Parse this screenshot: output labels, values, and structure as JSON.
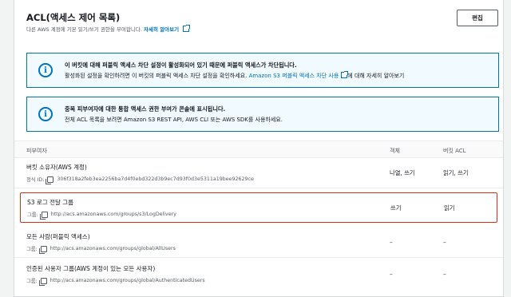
{
  "header": {
    "title": "ACL(액세스 제어 목록)",
    "subtitle": "다른 AWS 계정에 기본 읽기/쓰기 권한을 부여합니다.",
    "learn_more": "자세히 알아보기",
    "edit_label": "편집"
  },
  "alerts": [
    {
      "title": "이 버킷에 대해 퍼블릭 액세스 차단 설정이 활성화되어 있기 때문에 퍼블릭 액세스가 차단됩니다.",
      "body_prefix": "활성화된 설정을 확인하려면 이 버킷의 퍼블릭 액세스 차단 설정을 확인하세요. ",
      "body_link": "Amazon S3 퍼블릭 액세스 차단 사용",
      "body_suffix": "에 대해 자세히 알아보기"
    },
    {
      "title": "중복 피부여자에 대한 통합 액세스 권한 부여가 콘솔에 표시됩니다.",
      "body": "전체 ACL 목록을 보려면 Amazon S3 REST API, AWS CLI 또는 AWS SDK를 사용하세요."
    }
  ],
  "table": {
    "columns": [
      "피부여자",
      "객체",
      "버킷 ACL"
    ],
    "rows": [
      {
        "grantee": "버킷 소유자(AWS 계정)",
        "id_label": "정식 ID:",
        "id_value": "306f318a2feb3ea2256ba7d4f0ebd322d3b9ec7d93f0d3e5311a19bee92629ce",
        "object": "나열, 쓰기",
        "bucket_acl": "읽기, 쓰기"
      },
      {
        "grantee": "S3 로그 전달 그룹",
        "id_label": "그룹:",
        "id_value": "http://acs.amazonaws.com/groups/s3/LogDelivery",
        "object": "쓰기",
        "bucket_acl": "읽기"
      },
      {
        "grantee": "모든 사람(퍼블릭 액세스)",
        "id_label": "그룹:",
        "id_value": "http://acs.amazonaws.com/groups/global/AllUsers",
        "object": "–",
        "bucket_acl": "–"
      },
      {
        "grantee": "인증된 사용자 그룹(AWS 계정이 있는 모든 사용자)",
        "id_label": "그룹:",
        "id_value": "http://acs.amazonaws.com/groups/global/AuthenticatedUsers",
        "object": "–",
        "bucket_acl": "–"
      }
    ]
  },
  "colors": {
    "link": "#0073bb",
    "alert_bg": "#f1faff",
    "highlight": "#d13212"
  }
}
